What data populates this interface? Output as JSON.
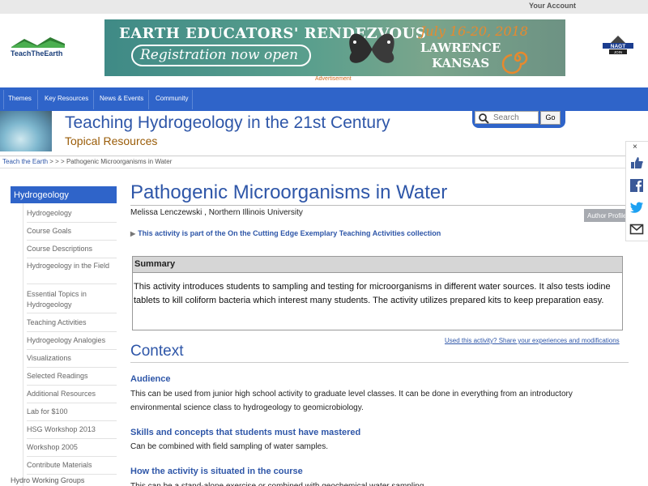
{
  "topbar": {
    "account_label": "Your Account"
  },
  "ad": {
    "line1": "EARTH EDUCATORS' RENDEZVOUS",
    "line2": "Registration now open",
    "dates": "July 16-20, 2018",
    "place1": "LAWRENCE",
    "place2": "KANSAS",
    "label": "Advertisement"
  },
  "logos": {
    "left": "TeachTheEarth",
    "right_top": "NAGT",
    "right_bottom": "JOIN"
  },
  "nav": {
    "items": [
      "Themes",
      "Key Resources",
      "News & Events",
      "Community"
    ]
  },
  "site": {
    "title": "Teaching Hydrogeology in the 21st Century",
    "subtitle": "Topical Resources"
  },
  "search": {
    "placeholder": "Search",
    "button": "Go"
  },
  "breadcrumb": {
    "home": "Teach the Earth",
    "sep": " > > > ",
    "current": "Pathogenic Microorganisms in Water"
  },
  "sidebar": {
    "header": "Hydrogeology",
    "items": [
      {
        "label": "Hydrogeology"
      },
      {
        "label": "Course Goals"
      },
      {
        "label": "Course Descriptions"
      },
      {
        "label": "Hydrogeology in the Field"
      },
      {
        "label": "Essential Topics in Hydrogeology"
      },
      {
        "label": "Teaching Activities"
      },
      {
        "label": "Hydrogeology Analogies"
      },
      {
        "label": "Visualizations"
      },
      {
        "label": "Selected Readings"
      },
      {
        "label": "Additional Resources"
      },
      {
        "label": "Lab for $100"
      },
      {
        "label": "HSG Workshop 2013"
      },
      {
        "label": "Workshop 2005"
      },
      {
        "label": "Contribute Materials"
      }
    ],
    "bottom": "Hydro Working Groups"
  },
  "main": {
    "title": "Pathogenic Microorganisms in Water",
    "author": "Melissa Lenczewski , Northern Illinois University",
    "author_profile": "Author Profile",
    "collection": "This activity is part of the On the Cutting Edge Exemplary Teaching Activities collection",
    "summary_heading": "Summary",
    "summary_text": "This activity introduces students to sampling and testing for microorganisms in different water sources. It also tests iodine tablets to kill coliform bacteria which interest many students. The activity utilizes prepared kits to keep preparation easy.",
    "used_link": "Used this activity? Share your experiences and modifications",
    "context_heading": "Context",
    "audience_heading": "Audience",
    "audience_text": "This can be used from junior high school activity to graduate level classes. It can be done in everything from an introductory environmental science class to hydrogeology to geomicrobiology.",
    "skills_heading": "Skills and concepts that students must have mastered",
    "skills_text": "Can be combined with field sampling of water samples.",
    "situated_heading": "How the activity is situated in the course",
    "situated_text": "This can be a stand-alone exercise or combined with geochemical water sampling."
  },
  "share": {
    "close": "×",
    "icons": [
      "thumbs-up-icon",
      "facebook-icon",
      "twitter-icon",
      "email-icon"
    ]
  }
}
